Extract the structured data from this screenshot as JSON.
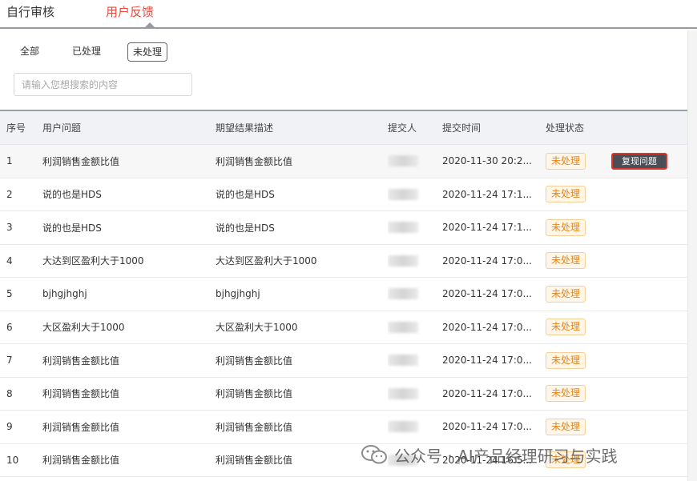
{
  "tabs": [
    {
      "label": "自行审核",
      "active": false
    },
    {
      "label": "用户反馈",
      "active": true
    }
  ],
  "filters": {
    "all": "全部",
    "done": "已处理",
    "todo": "未处理",
    "selected": "未处理"
  },
  "search": {
    "placeholder": "请输入您想搜索的内容",
    "value": ""
  },
  "table": {
    "headers": [
      "序号",
      "用户问题",
      "期望结果描述",
      "提交人",
      "提交时间",
      "处理状态"
    ],
    "rows": [
      {
        "no": "1",
        "question": "利润销售金额比值",
        "expected": "利润销售金额比值",
        "submitter": "",
        "time": "2020-11-30 20:2...",
        "status": "未处理",
        "action": "复现问题"
      },
      {
        "no": "2",
        "question": "说的也是HDS",
        "expected": "说的也是HDS",
        "submitter": "",
        "time": "2020-11-24 17:1...",
        "status": "未处理"
      },
      {
        "no": "3",
        "question": "说的也是HDS",
        "expected": "说的也是HDS",
        "submitter": "",
        "time": "2020-11-24 17:1...",
        "status": "未处理"
      },
      {
        "no": "4",
        "question": "大达到区盈利大于1000",
        "expected": "大达到区盈利大于1000",
        "submitter": "",
        "time": "2020-11-24 17:0...",
        "status": "未处理"
      },
      {
        "no": "5",
        "question": "bjhgjhghj",
        "expected": "bjhgjhghj",
        "submitter": "",
        "time": "2020-11-24 17:0...",
        "status": "未处理"
      },
      {
        "no": "6",
        "question": "大区盈利大于1000",
        "expected": "大区盈利大于1000",
        "submitter": "",
        "time": "2020-11-24 17:0...",
        "status": "未处理"
      },
      {
        "no": "7",
        "question": "利润销售金额比值",
        "expected": "利润销售金额比值",
        "submitter": "",
        "time": "2020-11-24 17:0...",
        "status": "未处理"
      },
      {
        "no": "8",
        "question": "利润销售金额比值",
        "expected": "利润销售金额比值",
        "submitter": "",
        "time": "2020-11-24 17:0...",
        "status": "未处理"
      },
      {
        "no": "9",
        "question": "利润销售金额比值",
        "expected": "利润销售金额比值",
        "submitter": "",
        "time": "2020-11-24 17:0...",
        "status": "未处理"
      },
      {
        "no": "10",
        "question": "利润销售金额比值",
        "expected": "利润销售金额比值",
        "submitter": "",
        "time": "2020-11-24 16:5...",
        "status": "未处理"
      }
    ]
  },
  "watermark": {
    "text": "公众号 · AI产品经理研习与实践",
    "icon": "wechat-icon"
  },
  "colors": {
    "accent": "#e74b3c",
    "status_text": "#e8851a",
    "status_bg": "#fff6e8",
    "action_bg": "#4a4f57",
    "action_border": "#d63a2f"
  }
}
